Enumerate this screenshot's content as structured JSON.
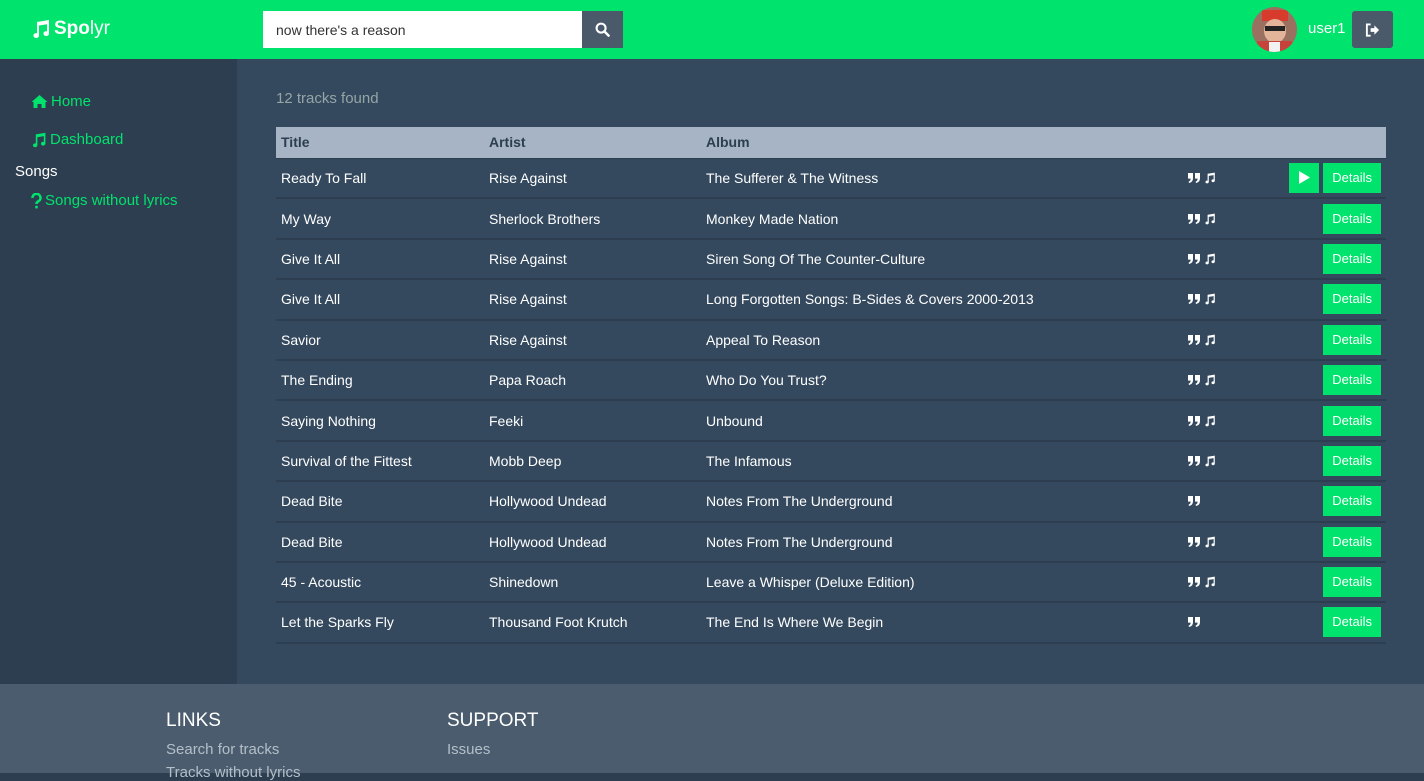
{
  "brand": {
    "name_part1": "Spo",
    "name_part2": "lyr"
  },
  "colors": {
    "accent": "#00e36c",
    "header_bg": "#00e36c",
    "sidebar_bg": "#2c3e50",
    "main_bg": "#34495e",
    "table_header_bg": "#a6b4c5",
    "footer_bg": "#4a5c6d"
  },
  "search": {
    "value": "now there's a reason",
    "icon": "search-icon"
  },
  "user": {
    "name": "user1",
    "logout_icon": "sign-out-icon"
  },
  "sidebar": {
    "home": "Home",
    "dashboard": "Dashboard",
    "songs_heading": "Songs",
    "songs_without_lyrics": "Songs without lyrics"
  },
  "results": {
    "summary": "12 tracks found",
    "columns": [
      "Title",
      "Artist",
      "Album"
    ],
    "details_label": "Details",
    "rows": [
      {
        "title": "Ready To Fall",
        "artist": "Rise Against",
        "album": "The Sufferer & The Witness",
        "lyrics": true,
        "music": true,
        "playable": true
      },
      {
        "title": "My Way",
        "artist": "Sherlock Brothers",
        "album": "Monkey Made Nation",
        "lyrics": true,
        "music": true,
        "playable": false
      },
      {
        "title": "Give It All",
        "artist": "Rise Against",
        "album": "Siren Song Of The Counter-Culture",
        "lyrics": true,
        "music": true,
        "playable": false
      },
      {
        "title": "Give It All",
        "artist": "Rise Against",
        "album": "Long Forgotten Songs: B-Sides & Covers 2000-2013",
        "lyrics": true,
        "music": true,
        "playable": false
      },
      {
        "title": "Savior",
        "artist": "Rise Against",
        "album": "Appeal To Reason",
        "lyrics": true,
        "music": true,
        "playable": false
      },
      {
        "title": "The Ending",
        "artist": "Papa Roach",
        "album": "Who Do You Trust?",
        "lyrics": true,
        "music": true,
        "playable": false
      },
      {
        "title": "Saying Nothing",
        "artist": "Feeki",
        "album": "Unbound",
        "lyrics": true,
        "music": true,
        "playable": false
      },
      {
        "title": "Survival of the Fittest",
        "artist": "Mobb Deep",
        "album": "The Infamous",
        "lyrics": true,
        "music": true,
        "playable": false
      },
      {
        "title": "Dead Bite",
        "artist": "Hollywood Undead",
        "album": "Notes From The Underground",
        "lyrics": true,
        "music": false,
        "playable": false
      },
      {
        "title": "Dead Bite",
        "artist": "Hollywood Undead",
        "album": "Notes From The Underground",
        "lyrics": true,
        "music": true,
        "playable": false
      },
      {
        "title": "45 - Acoustic",
        "artist": "Shinedown",
        "album": "Leave a Whisper (Deluxe Edition)",
        "lyrics": true,
        "music": true,
        "playable": false
      },
      {
        "title": "Let the Sparks Fly",
        "artist": "Thousand Foot Krutch",
        "album": "The End Is Where We Begin",
        "lyrics": true,
        "music": false,
        "playable": false
      }
    ]
  },
  "footer": {
    "links_heading": "LINKS",
    "links": [
      "Search for tracks",
      "Tracks without lyrics"
    ],
    "support_heading": "SUPPORT",
    "support_links": [
      "Issues"
    ]
  }
}
